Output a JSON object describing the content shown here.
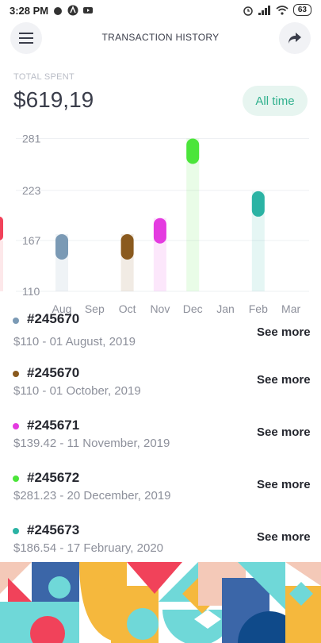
{
  "status": {
    "time": "3:28 PM",
    "battery": "63"
  },
  "header": {
    "title": "TRANSACTION HISTORY",
    "menu_icon": "menu-icon",
    "share_icon": "share-icon"
  },
  "summary": {
    "label": "TOTAL SPENT",
    "value": "$619,19",
    "period_button": "All time"
  },
  "chart_data": {
    "type": "bar",
    "categories": [
      "Aug",
      "Sep",
      "Oct",
      "Nov",
      "Dec",
      "Jan",
      "Feb",
      "Mar"
    ],
    "values": [
      174,
      null,
      174,
      192,
      281,
      null,
      222,
      null
    ],
    "colors": [
      "#7b9ab5",
      null,
      "#8a5a1e",
      "#e43be0",
      "#4be53a",
      null,
      "#2bb3a4",
      null
    ],
    "yticks": [
      110,
      167,
      223,
      281
    ],
    "ylim": [
      110,
      285
    ],
    "gridlines": true
  },
  "transactions": [
    {
      "id": "#245670",
      "detail": "$110 - 01 August, 2019",
      "action": "See more",
      "color": "#7b9ab5"
    },
    {
      "id": "#245670",
      "detail": "$110 - 01 October, 2019",
      "action": "See more",
      "color": "#8a5a1e"
    },
    {
      "id": "#245671",
      "detail": "$139.42 - 11 November, 2019",
      "action": "See more",
      "color": "#e43be0"
    },
    {
      "id": "#245672",
      "detail": "$281.23 - 20 December, 2019",
      "action": "See more",
      "color": "#4be53a"
    },
    {
      "id": "#245673",
      "detail": "$186.54 - 17 February, 2020",
      "action": "See more",
      "color": "#2bb3a4"
    }
  ]
}
